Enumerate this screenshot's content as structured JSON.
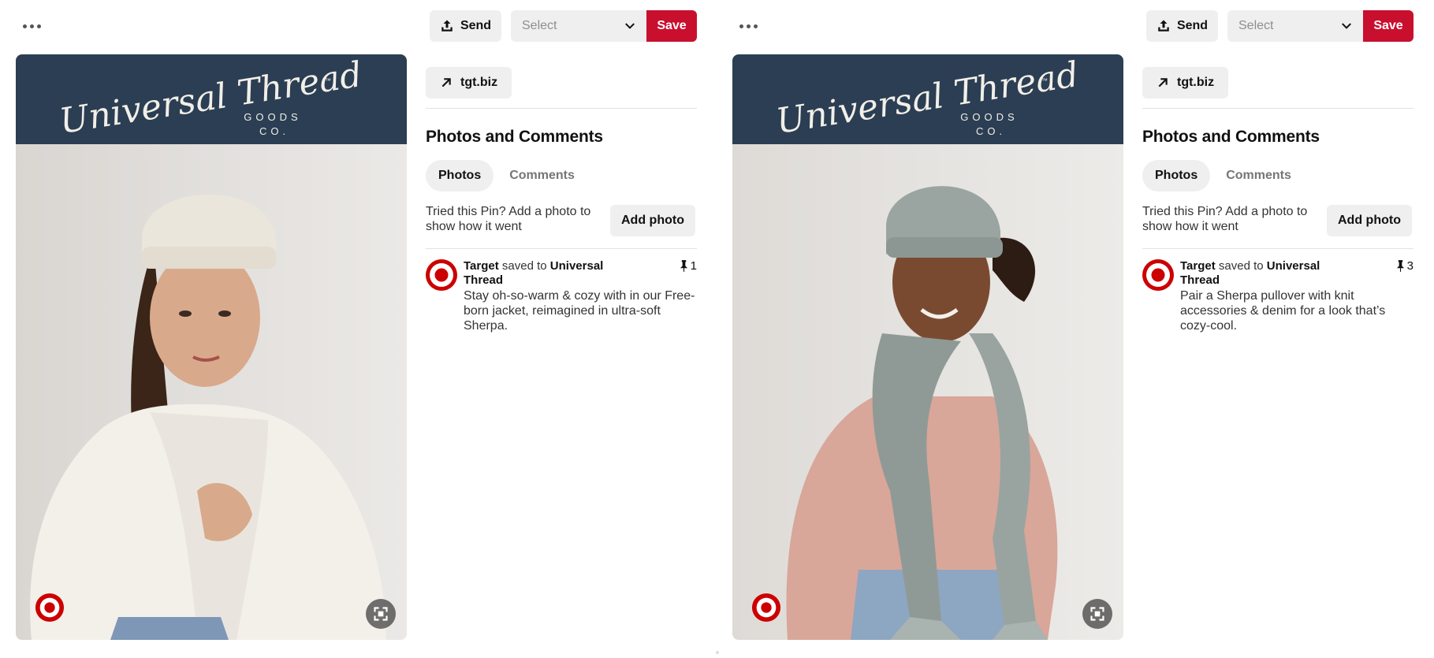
{
  "pins": [
    {
      "actions": {
        "send_label": "Send",
        "select_placeholder": "Select",
        "save_label": "Save"
      },
      "banner": {
        "brand_script": "Universal Thread",
        "tm": "™",
        "goods": "GOODS",
        "co": "CO."
      },
      "domain": "tgt.biz",
      "section_title": "Photos and Comments",
      "tabs": [
        "Photos",
        "Comments"
      ],
      "tried_text": "Tried this Pin? Add a photo to show how it went",
      "add_photo_label": "Add photo",
      "activity": {
        "user": "Target",
        "saved_to": "saved to",
        "board": "Universal Thread",
        "saves": "1",
        "description": "Stay oh-so-warm & cozy with in our Free-born jacket, reimagined in ultra-soft Sherpa."
      }
    },
    {
      "actions": {
        "send_label": "Send",
        "select_placeholder": "Select",
        "save_label": "Save"
      },
      "banner": {
        "brand_script": "Universal Thread",
        "tm": "™",
        "goods": "GOODS",
        "co": "CO."
      },
      "domain": "tgt.biz",
      "section_title": "Photos and Comments",
      "tabs": [
        "Photos",
        "Comments"
      ],
      "tried_text": "Tried this Pin? Add a photo to show how it went",
      "add_photo_label": "Add photo",
      "activity": {
        "user": "Target",
        "saved_to": "saved to",
        "board": "Universal Thread",
        "saves": "3",
        "description": "Pair a Sherpa pullover with knit accessories & denim for a look that’s cozy-cool."
      }
    }
  ],
  "colors": {
    "save": "#c8102e",
    "banner": "#2b3e53",
    "button_bg": "#efefef",
    "target_red": "#cc0000"
  },
  "icons": [
    "more-icon",
    "upload-icon",
    "chevron-down-icon",
    "arrow-up-right-icon",
    "pushpin-icon",
    "expand-icon",
    "target-logo-icon"
  ]
}
